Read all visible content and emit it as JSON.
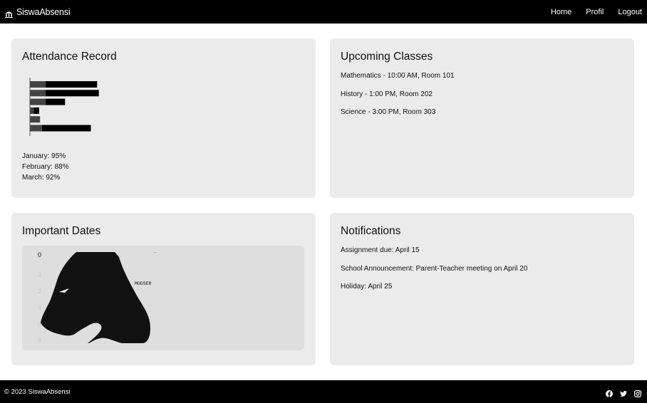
{
  "navbar": {
    "brand": "SiswaAbsensi",
    "brand_icon": "building-columns-icon",
    "links": [
      "Home",
      "Profil",
      "Logout"
    ]
  },
  "attendance": {
    "title": "Attendance Record",
    "chart_data": {
      "type": "bar",
      "orientation": "horizontal",
      "stacked": true,
      "categories": [
        "",
        "",
        "",
        "",
        "",
        ""
      ],
      "series": [
        {
          "values": [
            17,
            17,
            17,
            4,
            11,
            13
          ],
          "color": "#444444"
        },
        {
          "values": [
            58,
            60,
            22,
            6,
            0,
            55
          ],
          "color": "#000000"
        }
      ],
      "xlim": [
        0,
        80
      ]
    },
    "stats": [
      "January: 95%",
      "February: 88%",
      "March: 92%"
    ]
  },
  "classes": {
    "title": "Upcoming Classes",
    "items": [
      "Mathematics - 10:00 AM, Room 101",
      "History - 1:00 PM, Room 202",
      "Science - 3:00 PM, Room 303"
    ]
  },
  "dates": {
    "title": "Important Dates",
    "image_label": "MODSER",
    "image_icon": "horse-head-illustration"
  },
  "notifications": {
    "title": "Notifications",
    "items": [
      "Assignment due: April 15",
      "School Announcement: Parent-Teacher meeting on April 20",
      "Holiday: April 25"
    ]
  },
  "footer": {
    "copyright": "© 2023 SiswaAbsensi",
    "social_icons": [
      "facebook-icon",
      "twitter-icon",
      "instagram-icon"
    ]
  }
}
